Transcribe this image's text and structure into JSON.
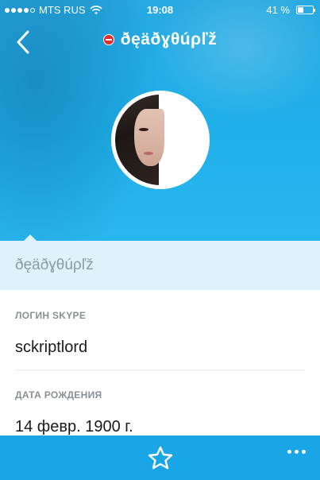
{
  "status_bar": {
    "carrier": "MTS RUS",
    "time": "19:08",
    "battery_percent_text": "41 %",
    "battery_level": 0.41,
    "signal_bars_filled": 4,
    "signal_bars_total": 5
  },
  "header": {
    "title": "ðęäðɣθúρľž",
    "presence_status": "do-not-disturb",
    "presence_color": "#e52d27",
    "back_icon": "chevron-left-icon"
  },
  "profile": {
    "display_name": "ðęäðɣθúρľž",
    "fields": [
      {
        "label": "ЛОГИН SKYPE",
        "value": "sckriptlord"
      },
      {
        "label": "ДАТА РОЖДЕНИЯ",
        "value": "14 февр. 1900 г."
      }
    ]
  },
  "bottom_bar": {
    "favorite_icon": "star-outline-icon",
    "more_icon": "more-dots-icon",
    "background": "#1aa6e6"
  },
  "colors": {
    "accent": "#27a9e1",
    "name_band": "#def2fb"
  }
}
